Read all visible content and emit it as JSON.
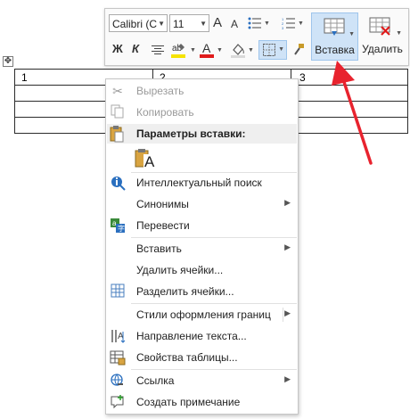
{
  "table": {
    "cells": [
      "1",
      "2",
      "3"
    ],
    "handle_icon": "move-table-icon"
  },
  "toolbar": {
    "font_name": "Calibri (С",
    "font_size": "11",
    "grow_font": "A",
    "shrink_font": "A",
    "bold": "Ж",
    "italic": "К",
    "font_color_letter": "A",
    "insert_label": "Вставка",
    "delete_label": "Удалить",
    "highlight_color": "#f5e300",
    "font_color": "#e01b1b"
  },
  "menu": {
    "cut": "Вырезать",
    "copy": "Копировать",
    "paste_options": "Параметры вставки:",
    "paste_option_letter": "A",
    "smart_lookup": "Интеллектуальный поиск",
    "synonyms": "Синонимы",
    "translate": "Перевести",
    "insert": "Вставить",
    "delete_cells": "Удалить ячейки...",
    "split_cells": "Разделить ячейки...",
    "border_styles": "Стили оформления границ",
    "text_direction": "Направление текста...",
    "table_properties": "Свойства таблицы...",
    "link": "Ссылка",
    "new_comment": "Создать примечание"
  },
  "colors": {
    "arrow": "#e8232e",
    "insert_highlight": "#cfe3f7"
  }
}
